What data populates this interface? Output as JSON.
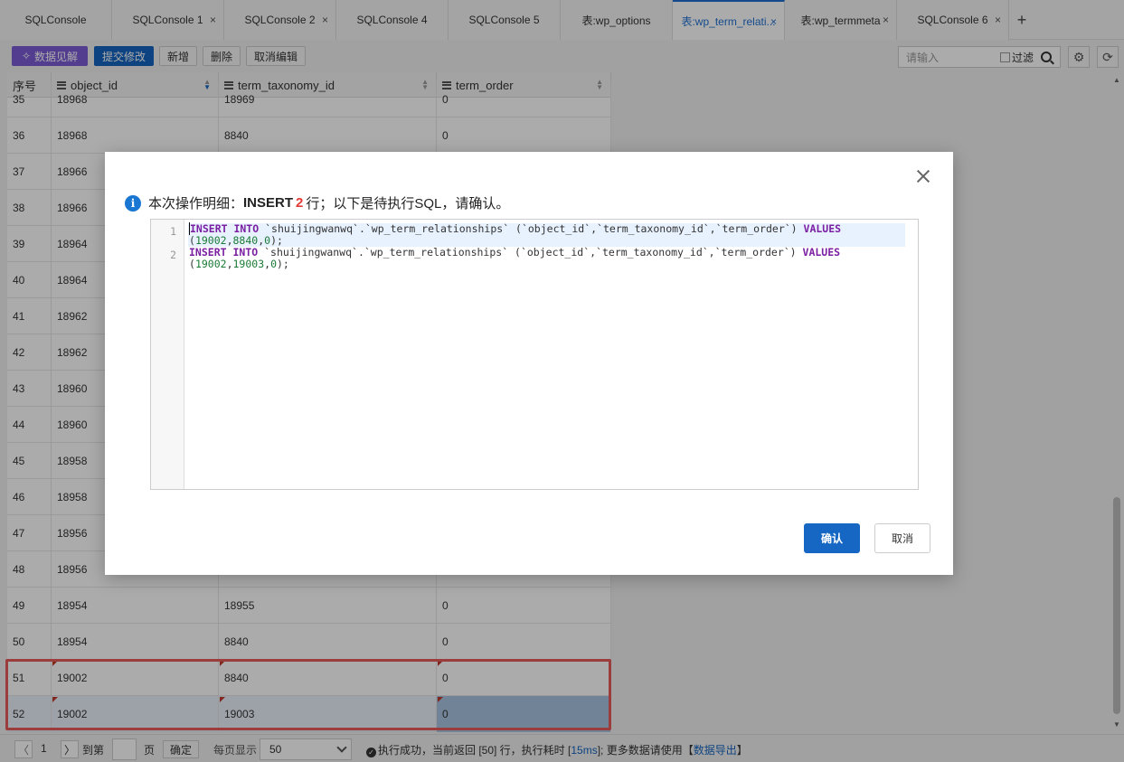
{
  "tabs": [
    {
      "label": "SQLConsole",
      "closable": false
    },
    {
      "label": "SQLConsole 1",
      "closable": true
    },
    {
      "label": "SQLConsole 2",
      "closable": true
    },
    {
      "label": "SQLConsole 4",
      "closable": false
    },
    {
      "label": "SQLConsole 5",
      "closable": false
    },
    {
      "label": "表:wp_options",
      "closable": false
    },
    {
      "label": "表:wp_term_relati...",
      "closable": true
    },
    {
      "label": "表:wp_termmeta",
      "closable": true
    },
    {
      "label": "SQLConsole 6",
      "closable": true
    }
  ],
  "toolbar": {
    "insight": "数据见解",
    "submit": "提交修改",
    "add": "新增",
    "delete": "删除",
    "cancel_edit": "取消编辑",
    "search_placeholder": "请输入",
    "filter": "过滤"
  },
  "grid": {
    "columns": [
      "序号",
      "object_id",
      "term_taxonomy_id",
      "term_order"
    ],
    "rows": [
      [
        "35",
        "18968",
        "18969",
        "0"
      ],
      [
        "36",
        "18968",
        "8840",
        "0"
      ],
      [
        "37",
        "18966",
        "",
        ""
      ],
      [
        "38",
        "18966",
        "",
        ""
      ],
      [
        "39",
        "18964",
        "",
        ""
      ],
      [
        "40",
        "18964",
        "",
        ""
      ],
      [
        "41",
        "18962",
        "",
        ""
      ],
      [
        "42",
        "18962",
        "",
        ""
      ],
      [
        "43",
        "18960",
        "",
        ""
      ],
      [
        "44",
        "18960",
        "",
        ""
      ],
      [
        "45",
        "18958",
        "",
        ""
      ],
      [
        "46",
        "18958",
        "",
        ""
      ],
      [
        "47",
        "18956",
        "",
        ""
      ],
      [
        "48",
        "18956",
        "",
        ""
      ],
      [
        "49",
        "18954",
        "18955",
        "0"
      ],
      [
        "50",
        "18954",
        "8840",
        "0"
      ],
      [
        "51",
        "19002",
        "8840",
        "0"
      ],
      [
        "52",
        "19002",
        "19003",
        "0"
      ]
    ]
  },
  "status": {
    "page_value": "1",
    "goto_label": "到第",
    "page_unit": "页",
    "confirm": "确定",
    "per_page_label": "每页显示",
    "per_page_value": "50",
    "message": "执行成功，当前返回 [50] 行，执行耗时 [",
    "elapsed": "15ms",
    "message_tail": "]; 更多数据请使用【",
    "export_link": "数据导出",
    "message_end": "】"
  },
  "modal": {
    "title_prefix": "本次操作明细：",
    "title_op": "INSERT",
    "title_count": "2",
    "title_suffix": "行；以下是待执行SQL，请确认。",
    "sql_lines": [
      {
        "n": "1",
        "a": "INSERT INTO `shuijingwanwq`.`wp_term_relationships` (`object_id`,`term_taxonomy_id`,`term_order`) VALUES",
        "b": "(19002,8840,0);"
      },
      {
        "n": "2",
        "a": "INSERT INTO `shuijingwanwq`.`wp_term_relationships` (`object_id`,`term_taxonomy_id`,`term_order`) VALUES",
        "b": "(19002,19003,0);"
      }
    ],
    "ok": "确认",
    "cancel": "取消"
  },
  "icons": {
    "info": "info-icon",
    "close": "close-icon",
    "settings": "gear-icon",
    "refresh": "refresh-icon",
    "search": "search-icon"
  },
  "colors": {
    "accent": "#1667c4",
    "highlight": "#e85c5c",
    "purple": "#7c5cd6"
  }
}
